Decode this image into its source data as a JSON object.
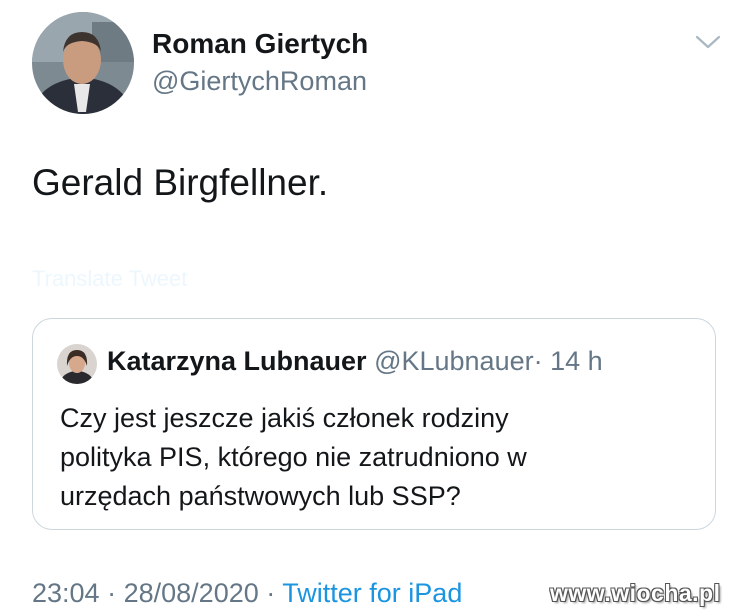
{
  "tweet": {
    "author_name": "Roman Giertych",
    "author_handle": "@GiertychRoman",
    "text": "Gerald Birgfellner.",
    "translate_link": "Translate Tweet",
    "menu_icon": "chevron-down-icon"
  },
  "quote": {
    "author_name": "Katarzyna Lubnauer",
    "author_handle": "@KLubnauer",
    "separator": "·",
    "time": "14 h",
    "lines": [
      "Czy jest jeszcze jakiś członek rodziny",
      "polityka PIS, którego nie zatrudniono w",
      "urzędach państwowych lub SSP?"
    ]
  },
  "meta": {
    "time": "23:04",
    "separator": "·",
    "date": "28/08/2020",
    "source": "Twitter for iPad"
  },
  "watermark": "www.wiocha.pl",
  "colors": {
    "text": "#14171a",
    "secondary": "#657786",
    "link": "#1b95e0",
    "border": "#ccd6dd"
  }
}
